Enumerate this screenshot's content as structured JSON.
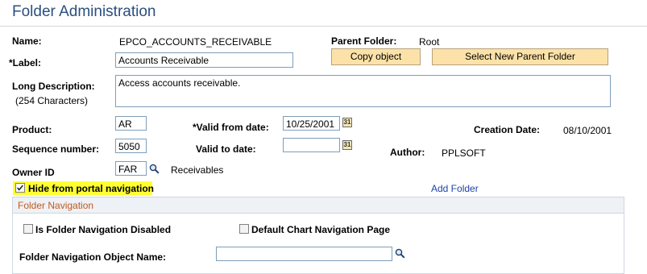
{
  "page": {
    "title": "Folder Administration"
  },
  "fields": {
    "name_label": "Name:",
    "name_value": "EPCO_ACCOUNTS_RECEIVABLE",
    "parent_folder_label": "Parent Folder:",
    "parent_folder_value": "Root",
    "label_label": "*Label:",
    "label_value": "Accounts Receivable",
    "long_desc_label": "Long Description:",
    "long_desc_hint": "(254 Characters)",
    "long_desc_value": "Access accounts receivable.",
    "product_label": "Product:",
    "product_value": "AR",
    "valid_from_label": "*Valid from date:",
    "valid_from_value": "10/25/2001",
    "creation_date_label": "Creation Date:",
    "creation_date_value": "08/10/2001",
    "sequence_label": "Sequence number:",
    "sequence_value": "5050",
    "valid_to_label": "Valid to date:",
    "valid_to_value": "",
    "author_label": "Author:",
    "author_value": "PPLSOFT",
    "owner_label": "Owner ID",
    "owner_value": "FAR",
    "owner_desc": "Receivables",
    "hide_portal_label": "Hide from portal navigation",
    "hide_portal_checked": true,
    "add_folder_link": "Add Folder"
  },
  "buttons": {
    "copy_object": "Copy object",
    "select_parent": "Select New Parent Folder"
  },
  "folder_navigation": {
    "section_title": "Folder Navigation",
    "nav_disabled_label": "Is Folder Navigation Disabled",
    "nav_disabled_checked": false,
    "default_chart_label": "Default Chart Navigation Page",
    "default_chart_checked": false,
    "object_name_label": "Folder Navigation Object Name:",
    "object_name_value": ""
  },
  "icons": {
    "calendar": "calendar-icon",
    "lookup": "magnifier-lookup-icon",
    "checkmark": "checkmark-icon"
  },
  "colors": {
    "title": "#2b4f7e",
    "button_bg": "#fce2a8",
    "highlight": "#ffff33",
    "section_title": "#c45a1b",
    "link": "#1f44a8"
  }
}
